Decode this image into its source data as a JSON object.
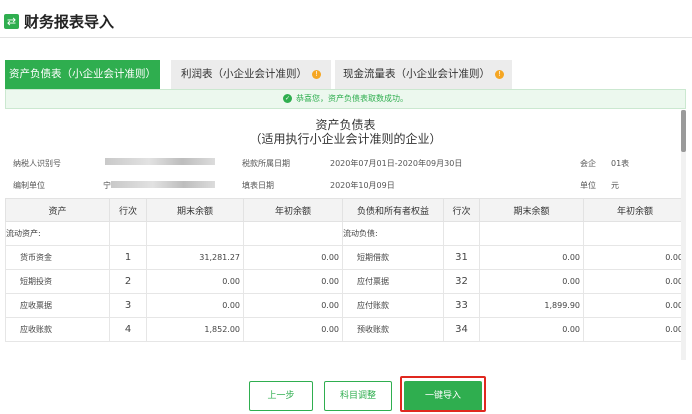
{
  "header": {
    "icon": "import-icon",
    "title": "财务报表导入"
  },
  "tabs": [
    {
      "label": "资产负债表（小企业会计准则）",
      "active": true,
      "warning": false
    },
    {
      "label": "利润表（小企业会计准则）",
      "active": false,
      "warning": true
    },
    {
      "label": "现金流量表（小企业会计准则）",
      "active": false,
      "warning": true
    }
  ],
  "notice": {
    "icon": "check-circle-icon",
    "text": "恭喜您，资产负债表取数成功。"
  },
  "report": {
    "title": "资产负债表",
    "subtitle": "（适用执行小企业会计准则的企业）",
    "taxpayer_id_label": "纳税人识别号",
    "period_label": "税款所属日期",
    "period_value": "2020年07月01日-2020年09月30日",
    "form_label": "会企",
    "form_value": "01表",
    "company_label": "编制单位",
    "company_value_prefix": "宁",
    "fill_date_label": "填表日期",
    "fill_date_value": "2020年10月09日",
    "unit_label": "单位",
    "unit_value": "元"
  },
  "table": {
    "headers": [
      "资产",
      "行次",
      "期末余额",
      "年初余额",
      "负债和所有者权益",
      "行次",
      "期末余额",
      "年初余额"
    ],
    "section_row": {
      "left": "流动资产:",
      "right": "流动负债:"
    },
    "rows": [
      {
        "asset": "货币资金",
        "row": "1",
        "end": "31,281.27",
        "begin": "0.00",
        "liability": "短期借款",
        "row2": "31",
        "end2": "0.00",
        "begin2": "0.00"
      },
      {
        "asset": "短期投资",
        "row": "2",
        "end": "0.00",
        "begin": "0.00",
        "liability": "应付票据",
        "row2": "32",
        "end2": "0.00",
        "begin2": "0.00"
      },
      {
        "asset": "应收票据",
        "row": "3",
        "end": "0.00",
        "begin": "0.00",
        "liability": "应付账款",
        "row2": "33",
        "end2": "1,899.90",
        "begin2": "0.00"
      },
      {
        "asset": "应收账款",
        "row": "4",
        "end": "1,852.00",
        "begin": "0.00",
        "liability": "预收账款",
        "row2": "34",
        "end2": "0.00",
        "begin2": "0.00"
      }
    ]
  },
  "buttons": {
    "prev": "上一步",
    "adjust": "科目调整",
    "import": "一键导入"
  },
  "colors": {
    "brand": "#2fae4f",
    "link": "#3b74d1",
    "warning": "#f5a623",
    "highlight": "#e0281f"
  }
}
